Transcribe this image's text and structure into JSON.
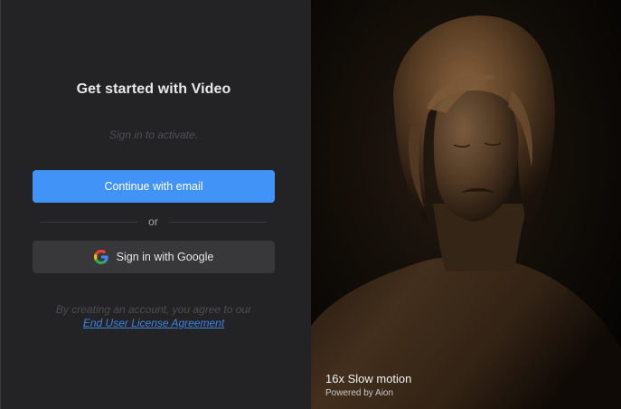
{
  "signin": {
    "title": "Get started with Video",
    "subtitle": "Sign in to activate.",
    "email_button_label": "Continue with email",
    "divider_text": "or",
    "google_button_label": "Sign in with Google",
    "legal_text": "By creating an account, you agree to our",
    "legal_link": "End User License Agreement"
  },
  "preview": {
    "title": "16x Slow motion",
    "subtitle": "Powered by Aion"
  },
  "colors": {
    "panel_background": "#232325",
    "primary_button": "#4193f7",
    "secondary_button": "#38383b",
    "link": "#3d86e0"
  },
  "icons": {
    "google": "google-logo-icon"
  }
}
